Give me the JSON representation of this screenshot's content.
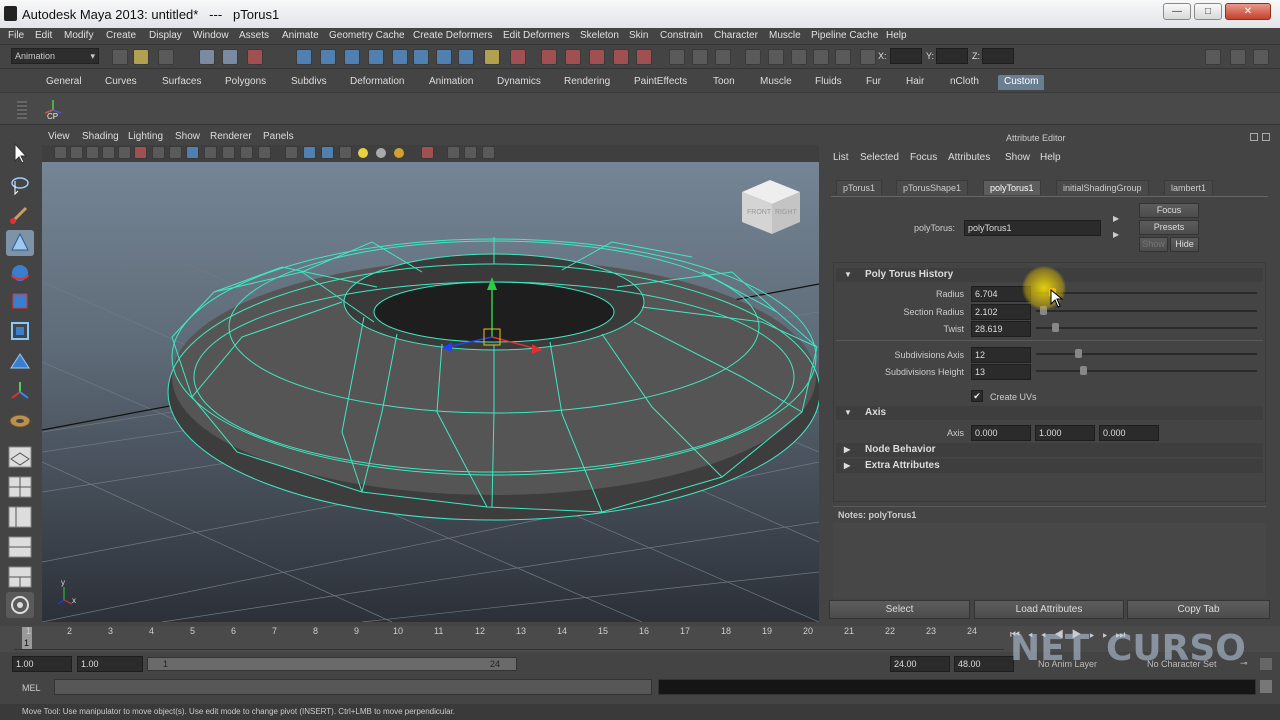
{
  "window": {
    "title": "Autodesk Maya 2013: untitled*   ---   pTorus1",
    "minimize": "—",
    "maximize": "□",
    "close": "✕"
  },
  "menubar": [
    "File",
    "Edit",
    "Modify",
    "Create",
    "Display",
    "Window",
    "Assets",
    "Animate",
    "Geometry Cache",
    "Create Deformers",
    "Edit Deformers",
    "Skeleton",
    "Skin",
    "Constrain",
    "Character",
    "Muscle",
    "Pipeline Cache",
    "Help"
  ],
  "statusline": {
    "menuset": "Animation",
    "x_label": "X:",
    "y_label": "Y:",
    "z_label": "Z:"
  },
  "shelf": {
    "tabs": [
      "General",
      "Curves",
      "Surfaces",
      "Polygons",
      "Subdivs",
      "Deformation",
      "Animation",
      "Dynamics",
      "Rendering",
      "PaintEffects",
      "Toon",
      "Muscle",
      "Fluids",
      "Fur",
      "Hair",
      "nCloth",
      "Custom"
    ],
    "active_tab": "Custom",
    "items": [
      {
        "label": "CP",
        "icon": "cp-shelf-icon"
      }
    ]
  },
  "viewport": {
    "menus": [
      "View",
      "Shading",
      "Lighting",
      "Show",
      "Renderer",
      "Panels"
    ],
    "viewcube": {
      "front": "FRONT",
      "right": "RIGHT"
    },
    "axis": {
      "x": "x",
      "y": "y"
    }
  },
  "attribute_editor": {
    "title": "Attribute Editor",
    "menus": [
      "List",
      "Selected",
      "Focus",
      "Attributes",
      "Show",
      "Help"
    ],
    "tabs": [
      "pTorus1",
      "pTorusShape1",
      "polyTorus1",
      "initialShadingGroup",
      "lambert1"
    ],
    "active_tab": "polyTorus1",
    "node_label": "polyTorus:",
    "node_value": "polyTorus1",
    "focus_button": "Focus",
    "presets_button": "Presets",
    "show_button": "Show",
    "hide_button": "Hide",
    "sections": {
      "history": "Poly Torus History",
      "axis": "Axis",
      "node_behavior": "Node Behavior",
      "extra": "Extra Attributes"
    },
    "attrs": {
      "radius": {
        "label": "Radius",
        "value": "6.704",
        "level": 0.09
      },
      "section_radius": {
        "label": "Section Radius",
        "value": "2.102",
        "level": 0.03
      },
      "twist": {
        "label": "Twist",
        "value": "28.619",
        "level": 0.1
      },
      "subdiv_axis": {
        "label": "Subdivisions Axis",
        "value": "12",
        "level": 0.2
      },
      "subdiv_height": {
        "label": "Subdivisions Height",
        "value": "13",
        "level": 0.22
      }
    },
    "create_uvs": {
      "label": "Create UVs",
      "checked": true,
      "mark": "✔"
    },
    "axis_label": "Axis",
    "axis_values": [
      "0.000",
      "1.000",
      "0.000"
    ],
    "notes_label": "Notes:  polyTorus1",
    "select_button": "Select",
    "load_button": "Load Attributes",
    "copy_button": "Copy Tab"
  },
  "timeline": {
    "ticks": [
      "1",
      "2",
      "3",
      "4",
      "5",
      "6",
      "7",
      "8",
      "9",
      "10",
      "11",
      "12",
      "13",
      "14",
      "15",
      "16",
      "17",
      "18",
      "19",
      "20",
      "21",
      "22",
      "23",
      "24"
    ],
    "current": "1",
    "range_start": "1.00",
    "range_start2": "1.00",
    "slider_start": "1",
    "slider_end": "24",
    "end1": "24.00",
    "end2": "48.00",
    "anim_layer": "No Anim Layer",
    "char_set": "No Character Set"
  },
  "command": {
    "label": "MEL"
  },
  "help_line": "Move Tool: Use manipulator to move object(s). Use edit mode to change pivot (INSERT).  Ctrl+LMB to move perpendicular.",
  "watermark": {
    "net": "NET",
    "curso": "CURSO"
  }
}
